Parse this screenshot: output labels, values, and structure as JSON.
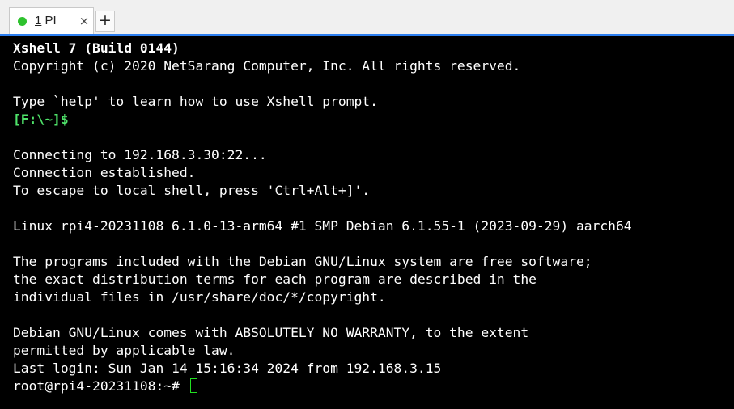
{
  "tab": {
    "label_prefix": "1",
    "label_rest": " PI",
    "close_glyph": "×",
    "add_glyph": "+",
    "status_color": "#2ec22e"
  },
  "terminal": {
    "lines": [
      "Xshell 7 (Build 0144)",
      "Copyright (c) 2020 NetSarang Computer, Inc. All rights reserved.",
      "",
      "Type `help' to learn how to use Xshell prompt.",
      "[F:\\~]$",
      "",
      "Connecting to 192.168.3.30:22...",
      "Connection established.",
      "To escape to local shell, press 'Ctrl+Alt+]'.",
      "",
      "Linux rpi4-20231108 6.1.0-13-arm64 #1 SMP Debian 6.1.55-1 (2023-09-29) aarch64",
      "",
      "The programs included with the Debian GNU/Linux system are free software;",
      "the exact distribution terms for each program are described in the",
      "individual files in /usr/share/doc/*/copyright.",
      "",
      "Debian GNU/Linux comes with ABSOLUTELY NO WARRANTY, to the extent",
      "permitted by applicable law.",
      "Last login: Sun Jan 14 15:16:34 2024 from 192.168.3.15"
    ],
    "prompt": "root@rpi4-20231108:~# ",
    "colors": {
      "background": "#000000",
      "text": "#ffffff",
      "local_prompt": "#4fe36a",
      "cursor": "#21e021"
    }
  }
}
